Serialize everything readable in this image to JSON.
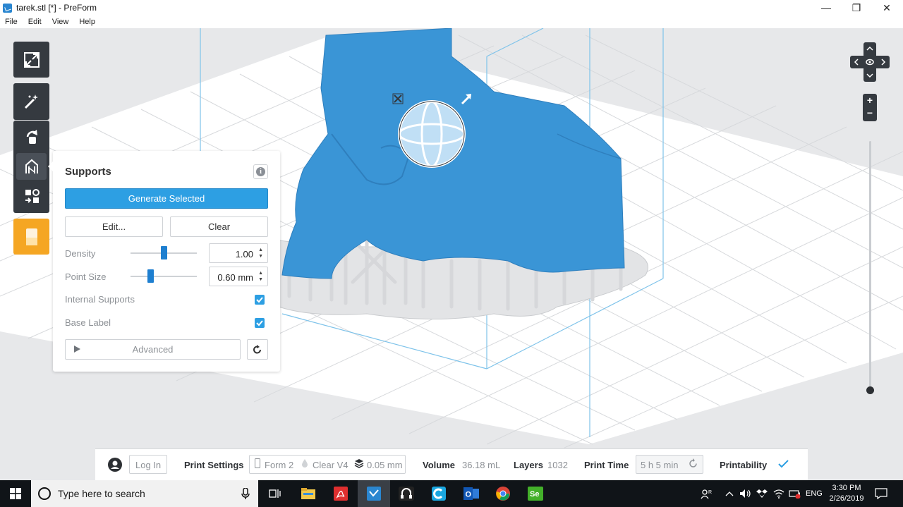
{
  "window": {
    "title": "tarek.stl [*] - PreForm",
    "minimize_glyph": "—",
    "maximize_glyph": "❐",
    "close_glyph": "✕"
  },
  "menu": [
    "File",
    "Edit",
    "View",
    "Help"
  ],
  "toolbar": {
    "icons": [
      "expand-icon",
      "magic-wand-icon",
      "orient-icon",
      "supports-icon",
      "layout-icon",
      "print-icon"
    ],
    "accent_color": "#f5a623",
    "dark_color": "#353a40"
  },
  "supports_panel": {
    "title": "Supports",
    "generate_label": "Generate Selected",
    "edit_label": "Edit...",
    "clear_label": "Clear",
    "density_label": "Density",
    "density_value": "1.00",
    "density_fraction": 0.5,
    "point_size_label": "Point Size",
    "point_size_value": "0.60 mm",
    "point_size_fraction": 0.3,
    "internal_supports_label": "Internal Supports",
    "internal_supports_checked": true,
    "base_label_label": "Base Label",
    "base_label_checked": true,
    "advanced_label": "Advanced",
    "primary_color": "#2d9fe3"
  },
  "navigation": {
    "zoom_in": "+",
    "zoom_out": "−",
    "zoom_fraction": 1.0
  },
  "status_bar": {
    "login_label": "Log In",
    "print_settings_label": "Print Settings",
    "printer": "Form 2",
    "resin": "Clear V4",
    "layer_height": "0.05 mm",
    "volume_label": "Volume",
    "volume_value": "36.18 mL",
    "layers_label": "Layers",
    "layers_value": "1032",
    "print_time_label": "Print Time",
    "print_time_value": "5 h 5 min",
    "printability_label": "Printability",
    "printability_ok": true
  },
  "taskbar": {
    "search_placeholder": "Type here to search",
    "apps": [
      "task-view-icon",
      "file-explorer-icon",
      "acrobat-icon",
      "preform-icon",
      "app-icon",
      "cortana-app-icon",
      "outlook-icon",
      "chrome-icon",
      "selenium-icon"
    ],
    "language": "ENG",
    "time": "3:30 PM",
    "date": "2/26/2019"
  }
}
